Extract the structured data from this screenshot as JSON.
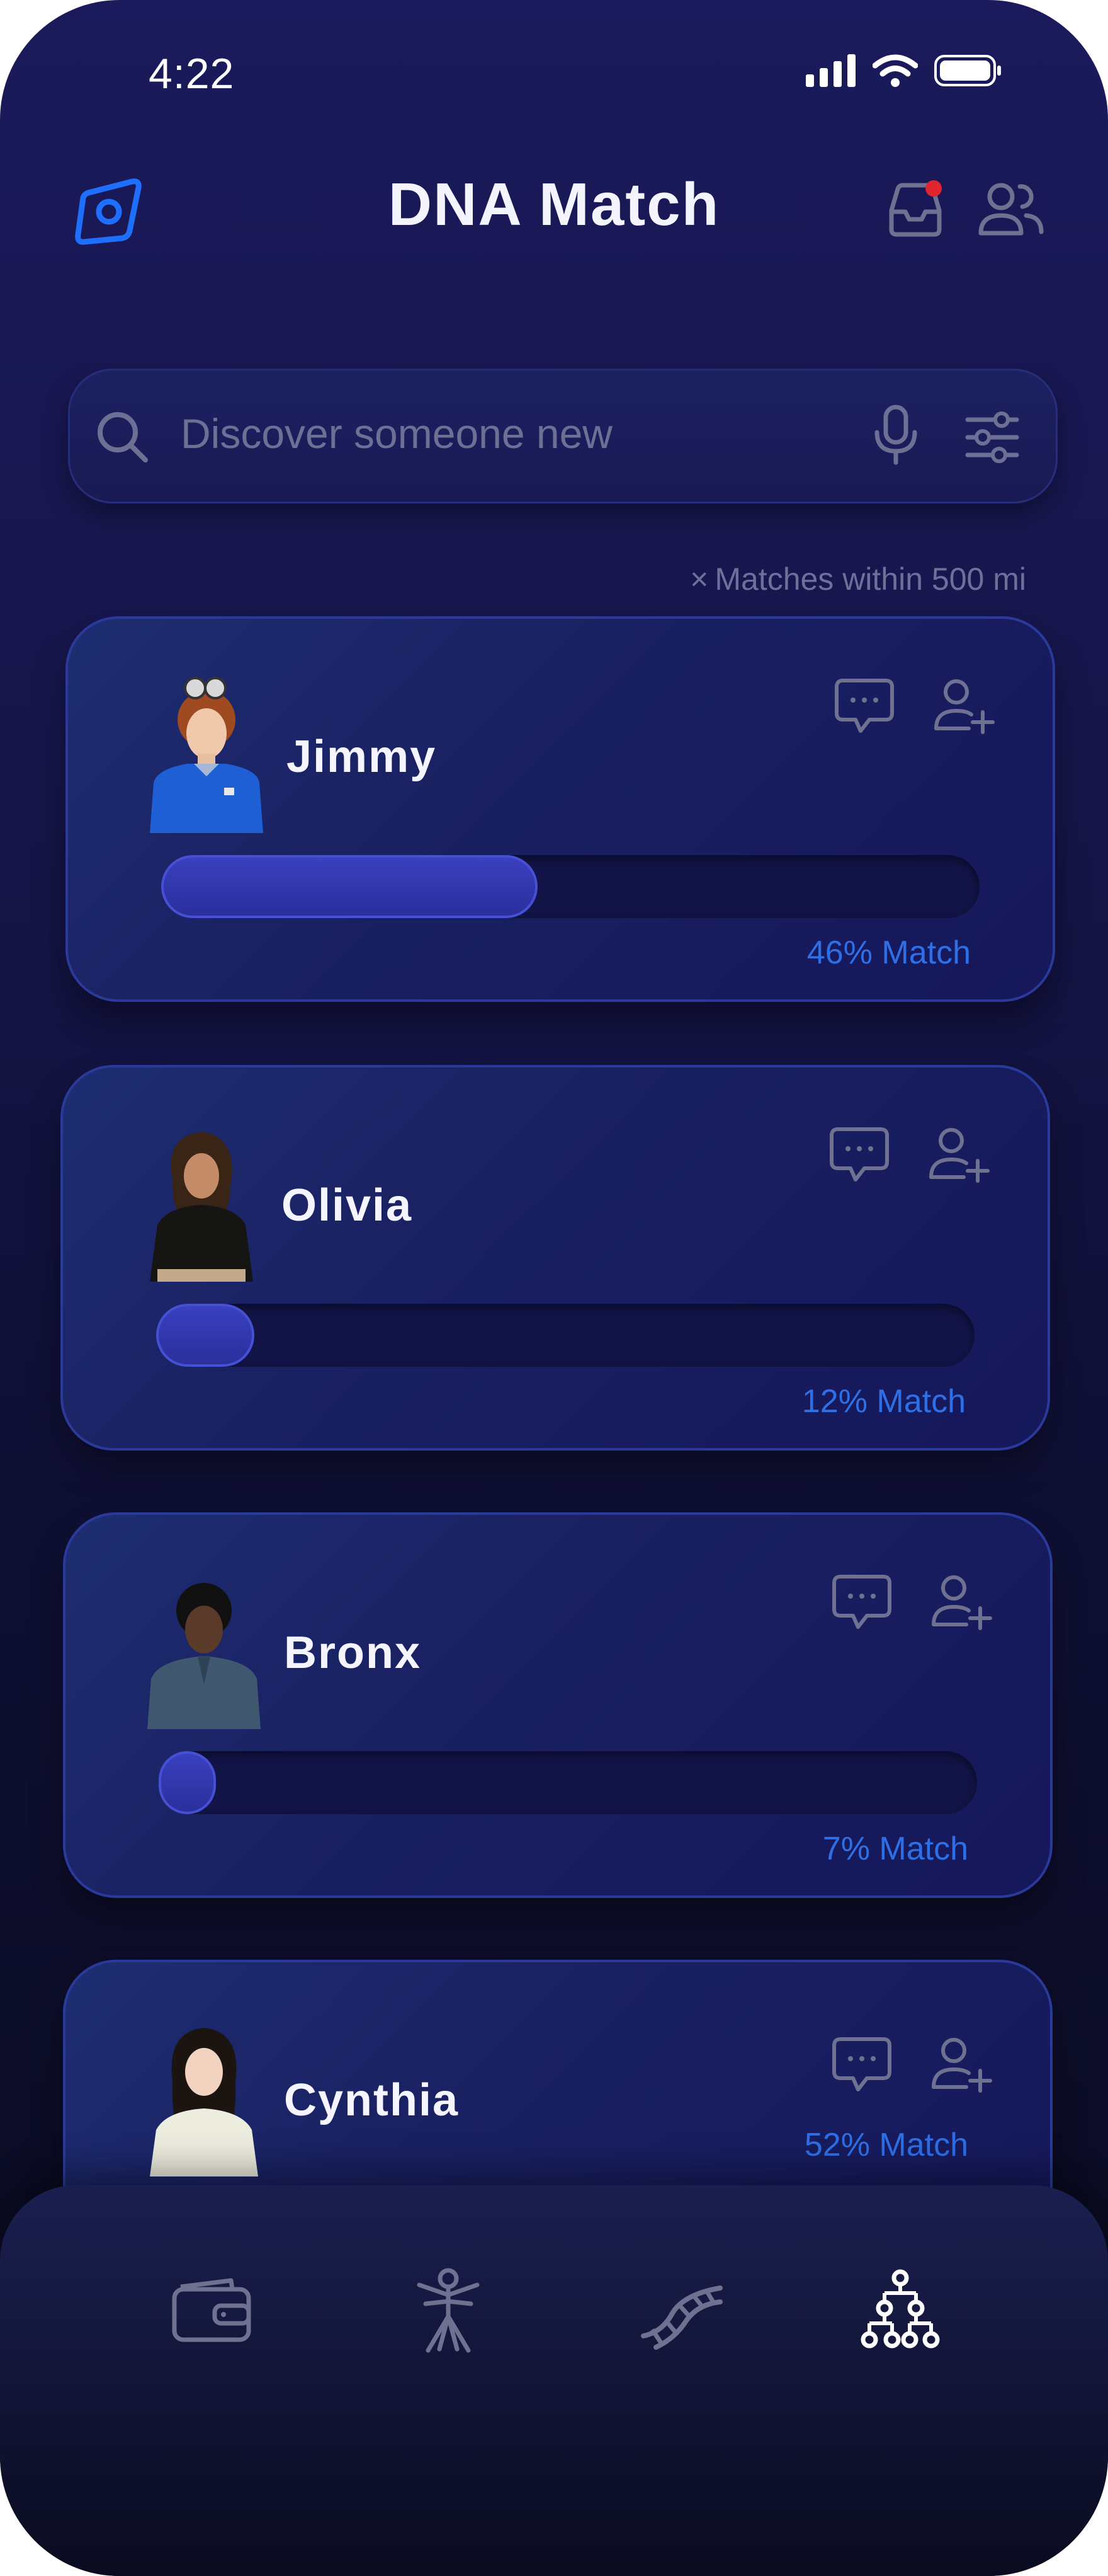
{
  "status_bar": {
    "time": "4:22"
  },
  "header": {
    "title": "DNA Match",
    "inbox_has_notification": true
  },
  "search": {
    "placeholder": "Discover someone new"
  },
  "filter_chip": {
    "prefix": "×",
    "label": "Matches within 500 mi"
  },
  "matches": [
    {
      "name": "Jimmy",
      "match_percent": 46,
      "match_label": "46% Match"
    },
    {
      "name": "Olivia",
      "match_percent": 12,
      "match_label": "12% Match"
    },
    {
      "name": "Bronx",
      "match_percent": 7,
      "match_label": "7% Match"
    },
    {
      "name": "Cynthia",
      "match_percent": 52,
      "match_label": "52% Match"
    }
  ],
  "tab_bar": {
    "tabs": [
      "wallet-icon",
      "body-icon",
      "dna-icon",
      "family-tree-icon"
    ],
    "active_index": 3
  },
  "colors": {
    "accent": "#2e6fe6",
    "notification": "#e0252f",
    "background": "#161549"
  }
}
